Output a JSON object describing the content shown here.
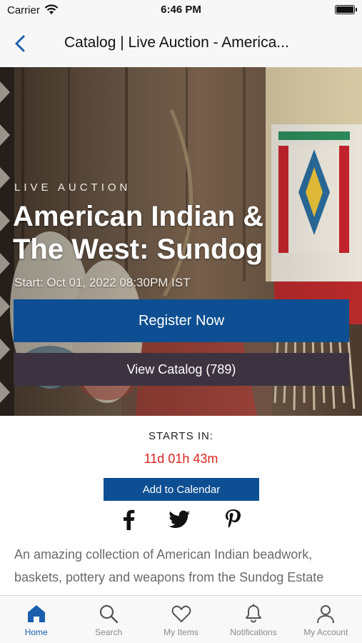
{
  "status_bar": {
    "carrier": "Carrier",
    "time": "6:46 PM",
    "battery_level": 1.0
  },
  "nav": {
    "back_icon": "chevron-left-icon",
    "title": "Catalog | Live Auction - America..."
  },
  "hero": {
    "eyebrow": "LIVE AUCTION",
    "title": "American Indian & The West: Sundog",
    "start": "Start: Oct 01, 2022 08:30PM IST",
    "register_label": "Register Now",
    "catalog_label": "View Catalog (789)"
  },
  "countdown": {
    "label": "STARTS IN:",
    "value": "11d 01h 43m",
    "calendar_label": "Add to Calendar"
  },
  "social": {
    "icons": [
      "facebook-icon",
      "twitter-icon",
      "pinterest-icon"
    ]
  },
  "description": "An amazing collection of American Indian beadwork, baskets, pottery and weapons from the Sundog Estate",
  "tabs": [
    {
      "label": "Home",
      "icon": "home-icon",
      "active": true
    },
    {
      "label": "Search",
      "icon": "search-icon",
      "active": false
    },
    {
      "label": "My Items",
      "icon": "heart-icon",
      "active": false
    },
    {
      "label": "Notifications",
      "icon": "bell-icon",
      "active": false
    },
    {
      "label": "My Account",
      "icon": "person-icon",
      "active": false
    }
  ],
  "colors": {
    "brand_blue": "#0d4f92",
    "catalog_button": "#3d3340",
    "countdown_red": "#d8261d",
    "active_tab": "#1a5fae",
    "inactive_tab": "#8a8a8a"
  }
}
